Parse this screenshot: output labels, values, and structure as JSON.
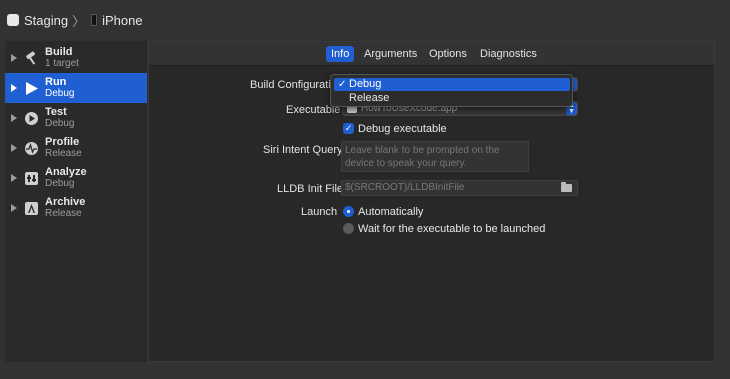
{
  "titlebar": {
    "scheme": "Staging",
    "separator": "〉",
    "destination": "iPhone"
  },
  "sidebar": {
    "items": [
      {
        "title": "Build",
        "subtitle": "1 target",
        "icon": "hammer-icon"
      },
      {
        "title": "Run",
        "subtitle": "Debug",
        "icon": "play-icon",
        "selected": true
      },
      {
        "title": "Test",
        "subtitle": "Debug",
        "icon": "wrench-icon"
      },
      {
        "title": "Profile",
        "subtitle": "Release",
        "icon": "waveform-icon"
      },
      {
        "title": "Analyze",
        "subtitle": "Debug",
        "icon": "analyze-icon"
      },
      {
        "title": "Archive",
        "subtitle": "Release",
        "icon": "archive-icon"
      }
    ]
  },
  "tabs": [
    {
      "label": "Info",
      "active": true
    },
    {
      "label": "Arguments"
    },
    {
      "label": "Options"
    },
    {
      "label": "Diagnostics"
    }
  ],
  "form": {
    "build_config_label": "Build Configuratio",
    "build_config_options": [
      "Debug",
      "Release"
    ],
    "build_config_selected": "Debug",
    "check_mark": "✓",
    "executable_label": "Executable",
    "executable_value": "HowToUseXcode.app",
    "debug_executable_label": "Debug executable",
    "debug_executable_checked": true,
    "siri_label": "Siri Intent Query",
    "siri_placeholder": "Leave blank to be prompted on the device to speak your query.",
    "lldb_label": "LLDB Init File",
    "lldb_placeholder": "$(SRCROOT)/LLDBInitFile",
    "launch_label": "Launch",
    "launch_options": [
      "Automatically",
      "Wait for the executable to be launched"
    ],
    "launch_selected": "Automatically"
  },
  "colors": {
    "accent": "#1f5fd1",
    "background": "#323232",
    "panel": "#282828"
  }
}
